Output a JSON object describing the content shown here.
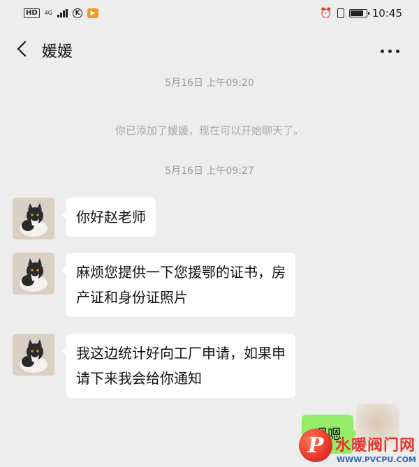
{
  "status_bar": {
    "hd": "HD",
    "network": "4G",
    "app_icon_text": "K",
    "time": "10:45",
    "icons": [
      "hd-icon",
      "signal-icon",
      "k-app-icon",
      "video-app-icon",
      "alarm-icon",
      "vibrate-icon",
      "battery-icon"
    ]
  },
  "header": {
    "title": "媛媛"
  },
  "messages": [
    {
      "type": "timestamp",
      "text": "5月16日 上午09:20"
    },
    {
      "type": "system",
      "text": "你已添加了媛媛，现在可以开始聊天了。"
    },
    {
      "type": "timestamp",
      "text": "5月16日 上午09:27"
    },
    {
      "type": "received",
      "lines": [
        "你好赵老师"
      ]
    },
    {
      "type": "received",
      "lines": [
        "麻烦您提供一下您援鄂的证书，房",
        "产证和身份证照片"
      ]
    },
    {
      "type": "received",
      "lines": [
        "我这边统计好向工厂申请，如果申",
        "请下来我会给你通知"
      ]
    },
    {
      "type": "sent",
      "text": "嗯嗯"
    }
  ],
  "watermark": {
    "logo_letter": "P",
    "name": "水暖阀门网",
    "url": "WWW.PVCPU.COM"
  },
  "colors": {
    "background": "#ededed",
    "received_bubble": "#ffffff",
    "sent_bubble": "#95ec69",
    "watermark_red": "#e8342a",
    "watermark_blue": "#2b6bbf"
  }
}
